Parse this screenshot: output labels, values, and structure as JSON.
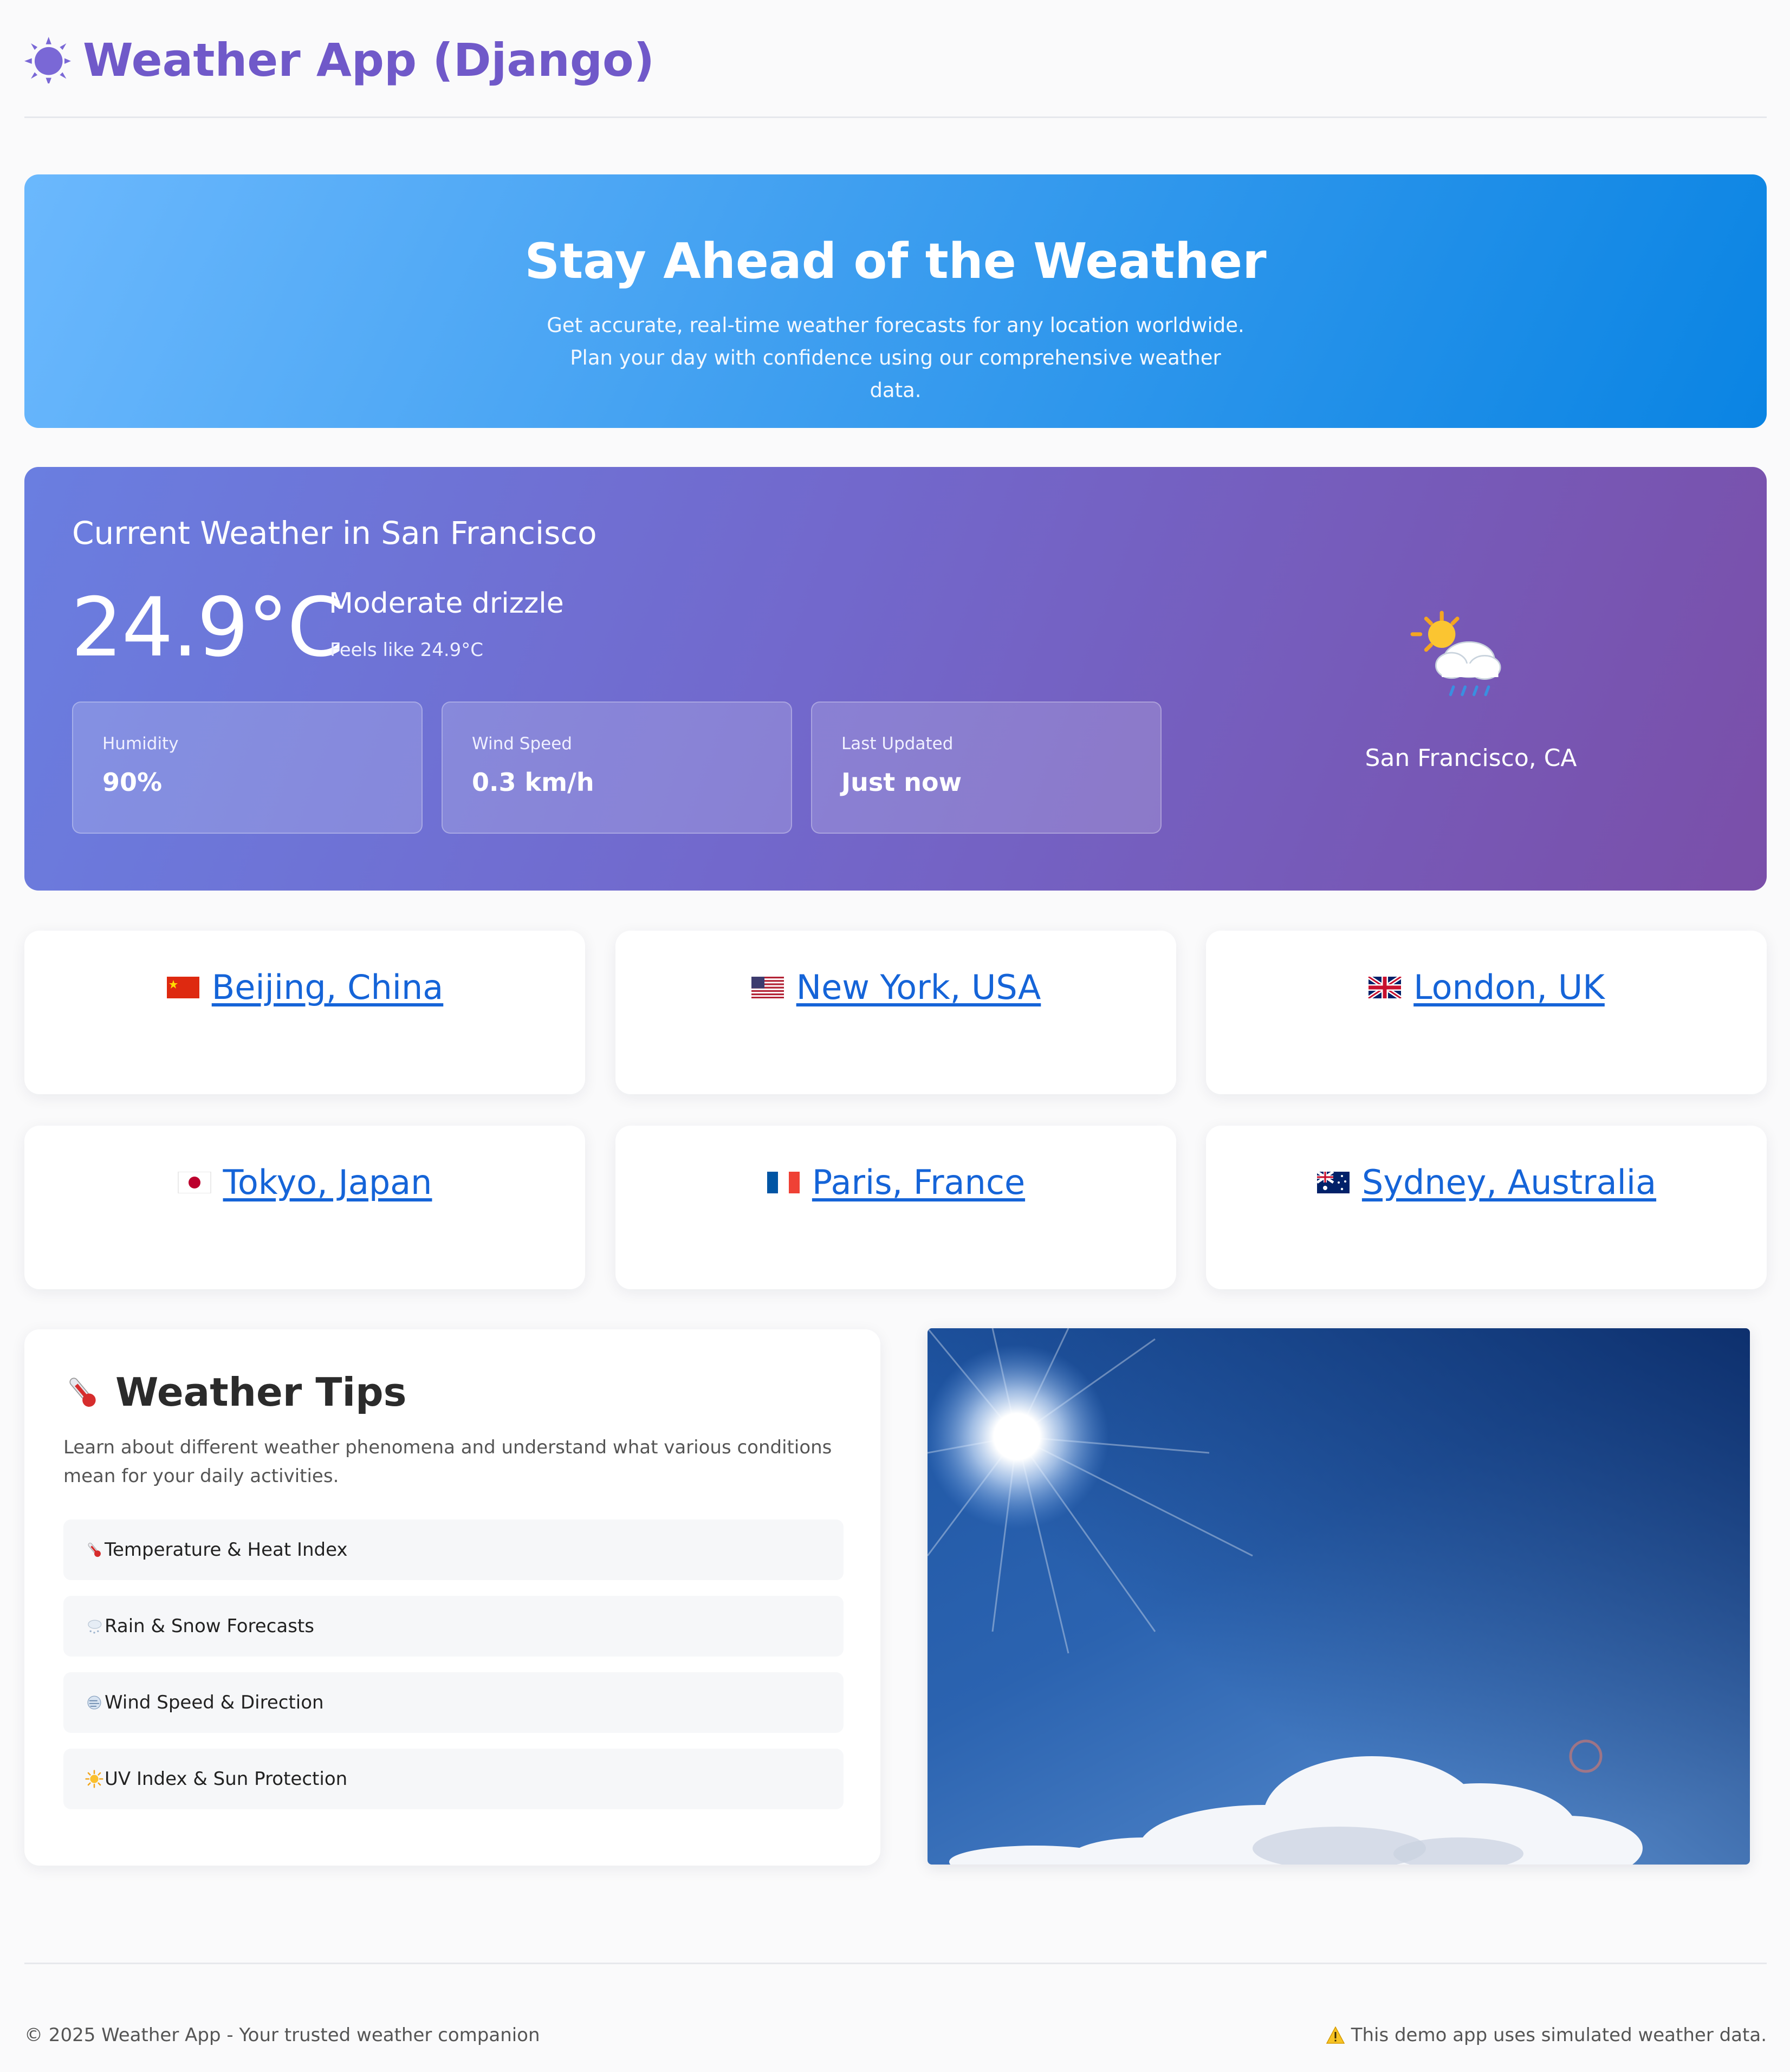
{
  "header": {
    "title": "Weather App (Django)",
    "icon": "sun-icon"
  },
  "hero": {
    "title": "Stay Ahead of the Weather",
    "description": "Get accurate, real-time weather forecasts for any location worldwide. Plan your day with confidence using our comprehensive weather data."
  },
  "current": {
    "heading": "Current Weather in San Francisco",
    "temperature": "24.9°C",
    "condition": "Moderate drizzle",
    "feels_like": "Feels like 24.9°C",
    "stats": [
      {
        "label": "Humidity",
        "value": "90%"
      },
      {
        "label": "Wind Speed",
        "value": "0.3 km/h"
      },
      {
        "label": "Last Updated",
        "value": "Just now"
      }
    ],
    "icon": "sun-behind-rain-cloud-icon",
    "location": "San Francisco, CA"
  },
  "cities": [
    {
      "label": "Beijing, China",
      "flag": "china-flag-icon"
    },
    {
      "label": "New York, USA",
      "flag": "usa-flag-icon"
    },
    {
      "label": "London, UK",
      "flag": "uk-flag-icon"
    },
    {
      "label": "Tokyo, Japan",
      "flag": "japan-flag-icon"
    },
    {
      "label": "Paris, France",
      "flag": "france-flag-icon"
    },
    {
      "label": "Sydney, Australia",
      "flag": "australia-flag-icon"
    }
  ],
  "tips": {
    "title": "Weather Tips",
    "description": "Learn about different weather phenomena and understand what various conditions mean for your daily activities.",
    "items": [
      {
        "label": "Temperature & Heat Index",
        "icon": "thermometer-icon"
      },
      {
        "label": "Rain & Snow Forecasts",
        "icon": "cloud-snow-icon"
      },
      {
        "label": "Wind Speed & Direction",
        "icon": "wind-face-icon"
      },
      {
        "label": "UV Index & Sun Protection",
        "icon": "sun-icon"
      }
    ]
  },
  "footer": {
    "copyright": "© 2025 Weather App - Your trusted weather companion",
    "notice": "This demo app uses simulated weather data."
  },
  "colors": {
    "brand": "#7059c9",
    "link": "#1564d8",
    "hero_start": "#6bb8fd",
    "hero_end": "#0a84e3",
    "current_start": "#6a7ee0",
    "current_end": "#7a4fa9"
  }
}
